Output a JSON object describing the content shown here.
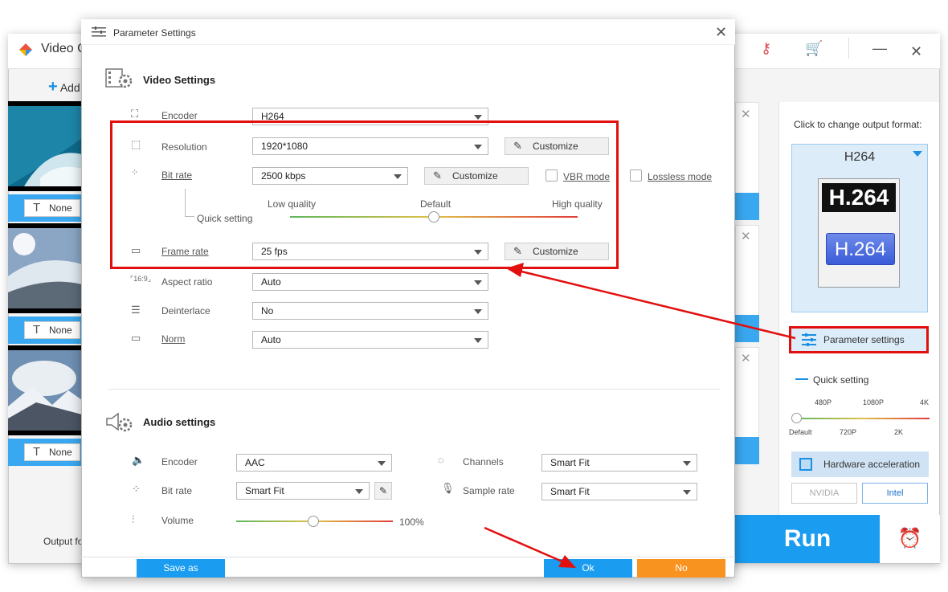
{
  "main_window": {
    "title": "Video C",
    "add_label": "Add",
    "none_label": "None",
    "output_label": "Output fo",
    "run_label": "Run"
  },
  "right_panel": {
    "click_label": "Click to change output format:",
    "format_name": "H264",
    "logo_text_top": "H.264",
    "logo_text_bottom": "H.264",
    "param_settings_label": "Parameter settings",
    "quick_setting_label": "Quick setting",
    "ticks_top": [
      "480P",
      "1080P",
      "4K"
    ],
    "ticks_bottom": [
      "Default",
      "720P",
      "2K"
    ],
    "hw_accel_label": "Hardware acceleration",
    "nvidia_label": "NVIDIA",
    "intel_label": "Intel"
  },
  "dialog": {
    "title": "Parameter Settings",
    "video_section": "Video Settings",
    "audio_section": "Audio settings",
    "video": {
      "encoder_label": "Encoder",
      "encoder_value": "H264",
      "resolution_label": "Resolution",
      "resolution_value": "1920*1080",
      "bitrate_label": "Bit rate",
      "bitrate_value": "2500 kbps",
      "vbr_label": "VBR mode",
      "lossless_label": "Lossless mode",
      "quick_setting_label": "Quick setting",
      "low_quality": "Low quality",
      "default": "Default",
      "high_quality": "High quality",
      "framerate_label": "Frame rate",
      "framerate_value": "25 fps",
      "aspect_label": "Aspect ratio",
      "aspect_value": "Auto",
      "deinterlace_label": "Deinterlace",
      "deinterlace_value": "No",
      "norm_label": "Norm",
      "norm_value": "Auto",
      "customize_label": "Customize"
    },
    "audio": {
      "encoder_label": "Encoder",
      "encoder_value": "AAC",
      "bitrate_label": "Bit rate",
      "bitrate_value": "Smart Fit",
      "volume_label": "Volume",
      "volume_value": "100%",
      "channels_label": "Channels",
      "channels_value": "Smart Fit",
      "sample_rate_label": "Sample rate",
      "sample_rate_value": "Smart Fit"
    },
    "buttons": {
      "save_as": "Save as",
      "ok": "Ok",
      "no": "No"
    }
  },
  "colors": {
    "accent": "#1a9cf0",
    "highlight": "#e20f0f",
    "orange": "#f7931e"
  }
}
